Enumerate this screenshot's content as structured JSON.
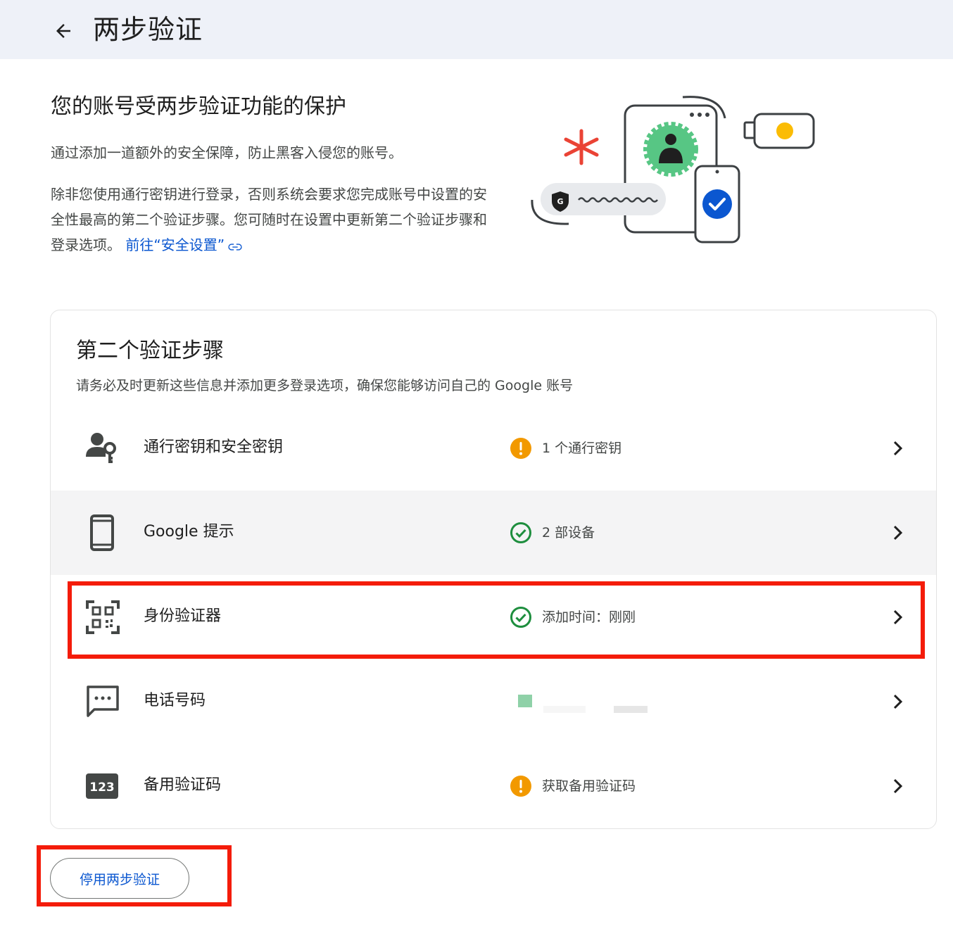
{
  "header": {
    "title": "两步验证",
    "back_icon": "arrow-back-icon"
  },
  "hero": {
    "title": "您的账号受两步验证功能的保护",
    "paragraph1": "通过添加一道额外的安全保障，防止黑客入侵您的账号。",
    "paragraph2": "除非您使用通行密钥进行登录，否则系统会要求您完成账号中设置的安全性最高的第二个验证步骤。您可随时在设置中更新第二个验证步骤和登录选项。",
    "link_label": "前往“安全设置”"
  },
  "second_step": {
    "title": "第二个验证步骤",
    "subtitle": "请务必及时更新这些信息并添加更多登录选项，确保您能够访问自己的 Google 账号",
    "items": [
      {
        "label": "通行密钥和安全密钥",
        "status": "1 个通行密钥",
        "icon": "passkey-person-key-icon",
        "status_icon": "warning-icon"
      },
      {
        "label": "Google 提示",
        "status": "2 部设备",
        "icon": "phone-icon",
        "status_icon": "check-circle-icon"
      },
      {
        "label": "身份验证器",
        "status": "添加时间：刚刚",
        "icon": "qr-code-scanner-icon",
        "status_icon": "check-circle-icon"
      },
      {
        "label": "电话号码",
        "status": "",
        "icon": "sms-chat-icon",
        "status_icon": "redacted-number"
      },
      {
        "label": "备用验证码",
        "status": "获取备用验证码",
        "icon": "code-123-icon",
        "status_icon": "warning-icon"
      }
    ]
  },
  "disable_button": {
    "label": "停用两步验证"
  },
  "colors": {
    "link": "#0b57d0",
    "warning": "#f29900",
    "success": "#1e8e3e",
    "annotation_red": "#f41c0a",
    "header_bg": "#eef1f8"
  }
}
